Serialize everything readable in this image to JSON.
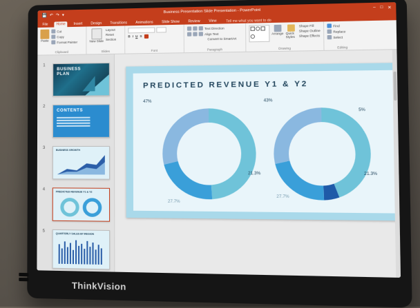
{
  "device": {
    "brand": "ThinkVision"
  },
  "window": {
    "title": "Business Presentation Slide Presentation - PowerPoint",
    "controls": [
      "–",
      "□",
      "✕"
    ],
    "quick_access": [
      "💾",
      "↶",
      "↷",
      "▾"
    ]
  },
  "ribbon": {
    "tabs": [
      "File",
      "Home",
      "Insert",
      "Design",
      "Transitions",
      "Animations",
      "Slide Show",
      "Review",
      "View"
    ],
    "active_tab": "Home",
    "tell_me": "Tell me what you want to do",
    "groups": {
      "clipboard": {
        "label": "Clipboard",
        "paste": "Paste",
        "cut": "Cut",
        "copy": "Copy",
        "format_painter": "Format Painter"
      },
      "slides": {
        "label": "Slides",
        "new_slide": "New Slide",
        "layout": "Layout",
        "reset": "Reset",
        "section": "Section"
      },
      "font": {
        "label": "Font"
      },
      "paragraph": {
        "label": "Paragraph",
        "text_direction": "Text Direction",
        "align_text": "Align Text",
        "convert": "Convert to SmartArt"
      },
      "drawing": {
        "label": "Drawing",
        "arrange": "Arrange",
        "quick_styles": "Quick Styles",
        "shape_fill": "Shape Fill",
        "shape_outline": "Shape Outline",
        "shape_effects": "Shape Effects"
      },
      "editing": {
        "label": "Editing",
        "find": "Find",
        "replace": "Replace",
        "select": "Select"
      }
    }
  },
  "thumbnails": {
    "numbers": [
      "1",
      "2",
      "3",
      "4",
      "5"
    ],
    "slide1_title_line1": "BUSINESS",
    "slide1_title_line2": "PLAN",
    "slide2_title": "CONTENTS",
    "slide3_title": "BUSINESS GROWTH",
    "slide4_title": "PREDICTED REVENUE Y1 & Y2",
    "slide5_title": "QUARTERLY SALES BY REGION"
  },
  "slide": {
    "title": "PREDICTED REVENUE Y1 & Y2",
    "colors": {
      "light_blue": "#6fc3d9",
      "mid_blue": "#3a9fd9",
      "pale_blue": "#8ab8e0",
      "dark_blue": "#1f5aa8",
      "title": "#24475e"
    }
  },
  "chart_data": [
    {
      "type": "pie",
      "title": "",
      "labels": [
        "",
        "",
        ""
      ],
      "values": [
        47,
        21.3,
        27.7
      ],
      "display_labels": [
        "47%",
        "21.3%",
        "27.7%"
      ]
    },
    {
      "type": "pie",
      "title": "",
      "labels": [
        "",
        "",
        "",
        ""
      ],
      "values": [
        43,
        5,
        21.3,
        27.7
      ],
      "display_labels": [
        "43%",
        "5%",
        "21.3%",
        "27.7%"
      ]
    }
  ]
}
